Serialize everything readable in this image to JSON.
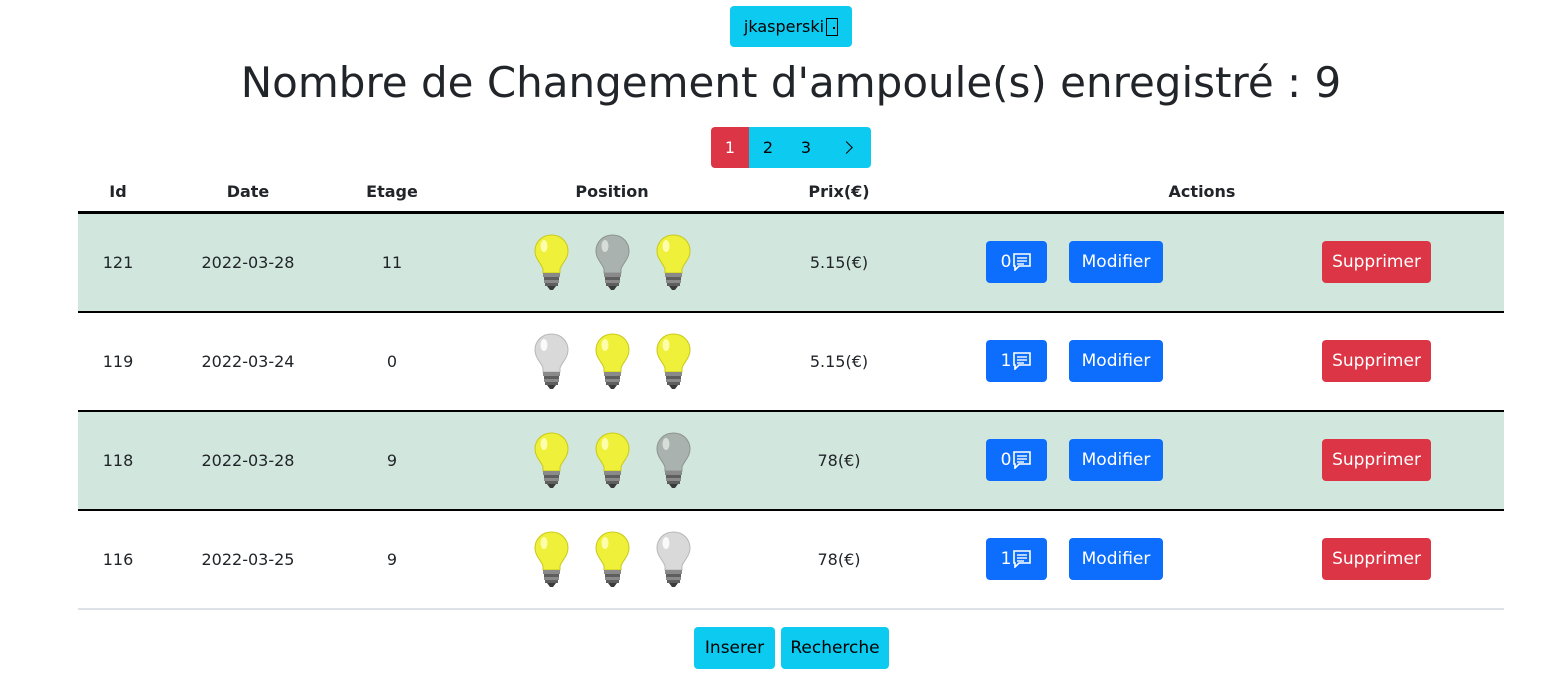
{
  "header": {
    "user_label": "jkasperski",
    "title": "Nombre de Changement d'ampoule(s) enregistré : 9"
  },
  "pagination": {
    "pages": [
      "1",
      "2",
      "3"
    ],
    "active_page": "1",
    "next_icon": "chevron-right-icon"
  },
  "table": {
    "headers": {
      "id": "Id",
      "date": "Date",
      "etage": "Etage",
      "position": "Position",
      "prix": "Prix(€)",
      "actions": "Actions"
    },
    "rows": [
      {
        "id": "121",
        "date": "2022-03-28",
        "etage": "11",
        "bulbs": [
          "on",
          "dim",
          "on"
        ],
        "prix": "5.15(€)",
        "comments": "0",
        "modify": "Modifier",
        "delete": "Supprimer"
      },
      {
        "id": "119",
        "date": "2022-03-24",
        "etage": "0",
        "bulbs": [
          "off",
          "on",
          "on"
        ],
        "prix": "5.15(€)",
        "comments": "1",
        "modify": "Modifier",
        "delete": "Supprimer"
      },
      {
        "id": "118",
        "date": "2022-03-28",
        "etage": "9",
        "bulbs": [
          "on",
          "on",
          "dim"
        ],
        "prix": "78(€)",
        "comments": "0",
        "modify": "Modifier",
        "delete": "Supprimer"
      },
      {
        "id": "116",
        "date": "2022-03-25",
        "etage": "9",
        "bulbs": [
          "on",
          "on",
          "off"
        ],
        "prix": "78(€)",
        "comments": "1",
        "modify": "Modifier",
        "delete": "Supprimer"
      }
    ]
  },
  "footer": {
    "insert_label": "Inserer",
    "search_label": "Recherche"
  },
  "colors": {
    "info": "#0dcaf0",
    "primary": "#0d6efd",
    "danger": "#dc3545",
    "row_shade": "#d1e7dd",
    "bulb_on": "#eef03a",
    "bulb_dim": "#a9b2ae",
    "bulb_off": "#d9d9d9"
  }
}
